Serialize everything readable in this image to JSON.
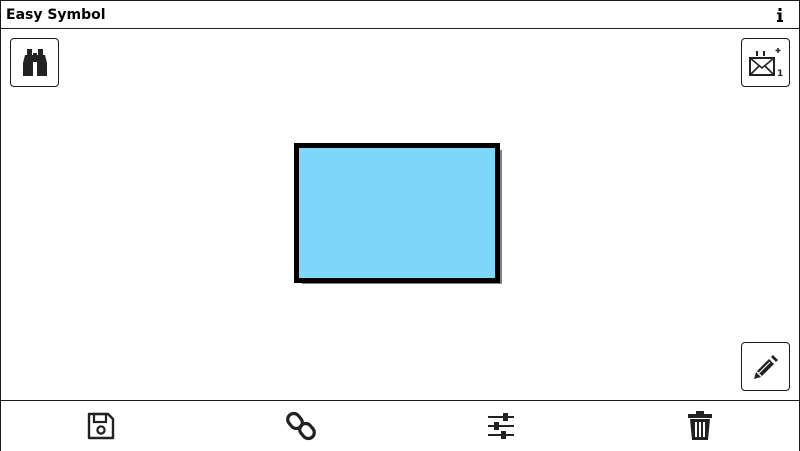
{
  "app": {
    "title": "Easy Symbol"
  },
  "titlebar": {
    "info_icon": "info-icon"
  },
  "toolbar": {
    "search_icon": "binoculars-icon",
    "new_symbol_icon": "new-symbol-icon",
    "new_symbol_badge": "1",
    "edit_icon": "pencil-icon"
  },
  "symbol": {
    "fill_color": "#7dd7fb",
    "border_color": "#000000",
    "shadow_color": "#808080"
  },
  "bottombar": {
    "save_icon": "floppy-disk-icon",
    "link_icon": "chain-link-icon",
    "settings_icon": "sliders-icon",
    "delete_icon": "trash-icon"
  }
}
